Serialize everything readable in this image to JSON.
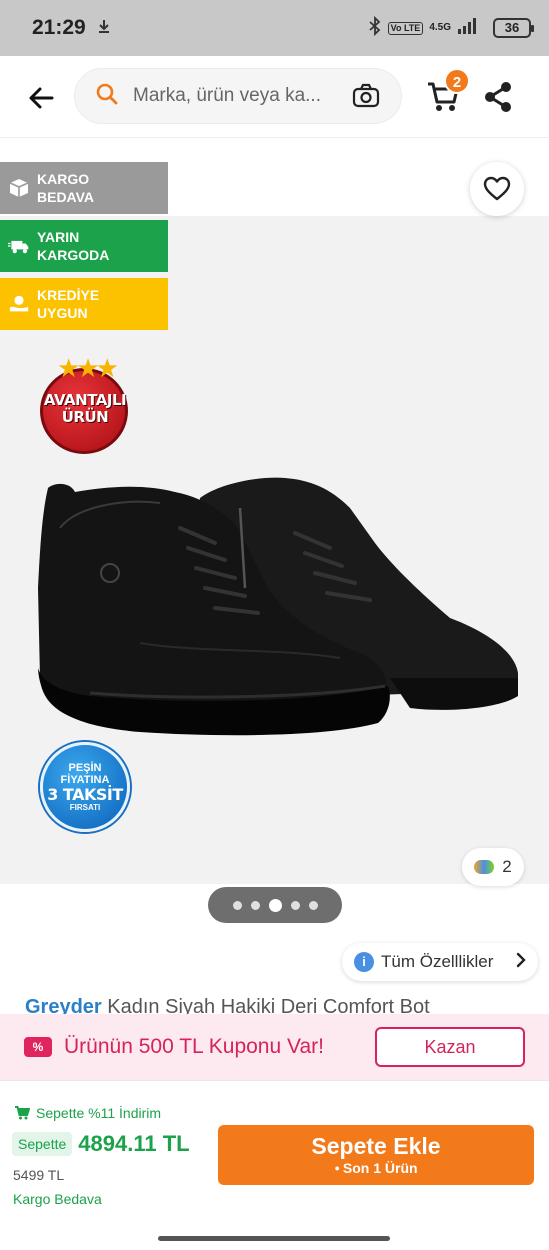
{
  "status": {
    "time": "21:29",
    "lte": "Vo LTE",
    "network": "4.5G",
    "battery": "36"
  },
  "header": {
    "search_placeholder": "Marka, ürün veya ka...",
    "cart_count": "2",
    "icons": [
      "back-arrow-icon",
      "search-icon",
      "camera-icon",
      "cart-icon",
      "share-icon"
    ]
  },
  "promos": [
    {
      "label": "KARGO BEDAVA",
      "line1": "KARGO",
      "line2": "BEDAVA",
      "icon": "box-icon",
      "color": "#9a9a9a"
    },
    {
      "label": "YARIN KARGODA",
      "line1": "YARIN",
      "line2": "KARGODA",
      "icon": "truck-icon",
      "color": "#1ba24a"
    },
    {
      "label": "KREDİYE UYGUN",
      "line1": "KREDİYE",
      "line2": "UYGUN",
      "icon": "coins-icon",
      "color": "#fcc200"
    }
  ],
  "badges": {
    "avantaj_line1": "AVANTAJLI",
    "avantaj_line2": "ÜRÜN",
    "taksit_line1": "PEŞİN",
    "taksit_line2": "FİYATINA",
    "taksit_line3": "3 TAKSİT",
    "taksit_line4": "FIRSATI"
  },
  "gallery": {
    "image_count": "2",
    "pages": 5,
    "active_page": 3
  },
  "features_button": "Tüm Özelllikler",
  "product": {
    "brand": "Greyder",
    "name": "Kadın Siyah Hakiki Deri Comfort Bot"
  },
  "coupon": {
    "text": "Ürünün 500 TL Kuponu Var!",
    "button": "Kazan",
    "icon_text": "%"
  },
  "bottom": {
    "discount": "Sepette %11 İndirim",
    "price_tag": "Sepette",
    "price": "4894.11 TL",
    "old_price": "5499 TL",
    "shipping": "Kargo Bedava",
    "add_button": "Sepete Ekle",
    "stock_note": "Son 1 Ürün"
  },
  "colors": {
    "accent": "#f27a1a",
    "green": "#1ba24a",
    "coupon_pink": "#d6245a",
    "brand_blue": "#2b7fc9"
  }
}
